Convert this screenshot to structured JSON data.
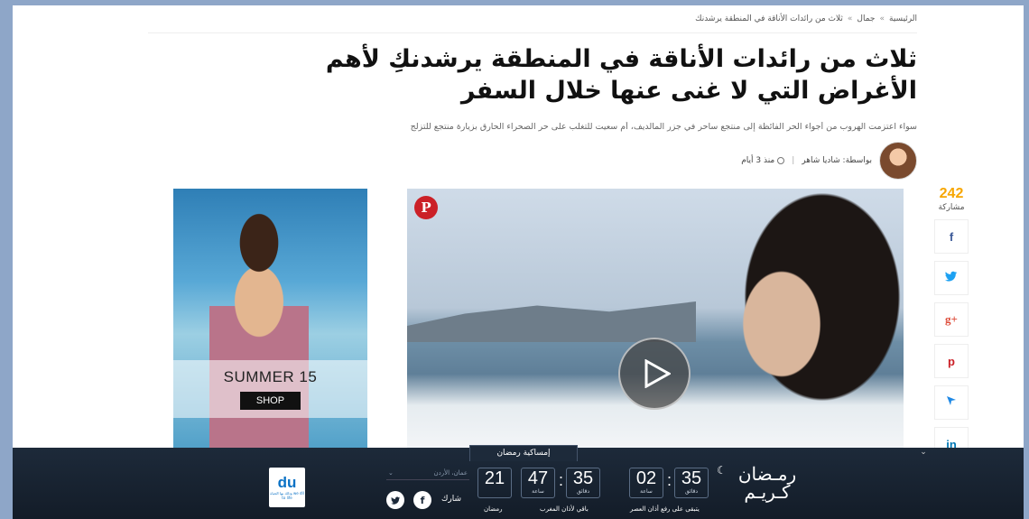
{
  "breadcrumb": {
    "home": "الرئيسية",
    "section": "جمال",
    "current": "ثلاث من رائدات الأناقة في المنطقة يرشدنك",
    "sep": "»"
  },
  "article": {
    "title": "ثلاث من رائدات الأناقة في المنطقة يرشدنكِ لأهم الأغراض التي لا غنى عنها خلال السفر",
    "subtitle": "سواء اعتزمت الهروب من أجواء الحر الفائظة إلى منتجع ساحر في جزر المالديف، أم سعيت للتغلب على حر الصحراء الحارق بزيارة منتجع للتزلج",
    "author": "بواسطة: شاديا شاهر",
    "time": "منذ 3 أيام",
    "sepbar": "|"
  },
  "ad": {
    "season": "SUMMER 15",
    "cta": "SHOP"
  },
  "hero": {
    "pinterest": "P"
  },
  "share": {
    "count": "242",
    "label": "مشاركة",
    "buttons": [
      {
        "icon": "facebook-icon",
        "glyph": "f",
        "color": "#3b5998"
      },
      {
        "icon": "twitter-icon",
        "glyph": "🐦",
        "color": "#1da1f2"
      },
      {
        "icon": "google-plus-icon",
        "glyph": "g+",
        "color": "#dd4b39"
      },
      {
        "icon": "pinterest-icon",
        "glyph": "p",
        "color": "#cb2027"
      },
      {
        "icon": "cursor-icon",
        "glyph": "➤",
        "color": "#1e88e5"
      },
      {
        "icon": "linkedin-icon",
        "glyph": "in",
        "color": "#0077b5"
      }
    ]
  },
  "ramadan_bar": {
    "tab": "إمساكية رمضان",
    "collapse": "⌄",
    "logo_text": "رمـضان كـريـم",
    "country_placeholder": "عمان، الأردن",
    "share_label": "شارك",
    "du": {
      "logo": "du",
      "tag": "وذلك بها الحياة\nwe dll to life"
    },
    "countdown_maghrib": {
      "minutes": "47",
      "seconds": "35",
      "hours_label": "ساعة",
      "minutes_label": "دقائق",
      "caption": "باقي لأذان المغرب"
    },
    "day": {
      "value": "21",
      "caption": "رمضان"
    },
    "countdown_asr": {
      "hours": "02",
      "minutes": "35",
      "hours_label": "ساعة",
      "minutes_label": "دقائق",
      "caption": "يتبقى على رفع أذان العصر"
    }
  }
}
